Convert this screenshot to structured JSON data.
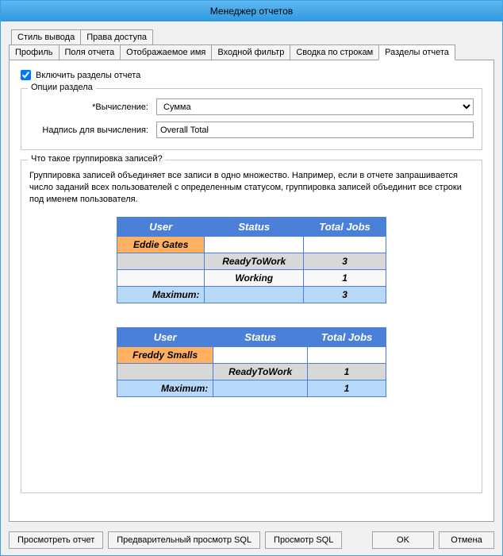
{
  "window": {
    "title": "Менеджер отчетов"
  },
  "tabs_top": [
    {
      "label": "Стиль вывода"
    },
    {
      "label": "Права доступа"
    }
  ],
  "tabs_bottom": [
    {
      "label": "Профиль"
    },
    {
      "label": "Поля отчета"
    },
    {
      "label": "Отображаемое имя"
    },
    {
      "label": "Входной фильтр"
    },
    {
      "label": "Сводка по строкам"
    },
    {
      "label": "Разделы отчета"
    }
  ],
  "enable_sections": {
    "label": "Включить разделы отчета",
    "checked": true
  },
  "section_options": {
    "legend": "Опции раздела",
    "calc_label": "*Вычисление:",
    "calc_value": "Сумма",
    "caption_label": "Надпись для вычисления:",
    "caption_value": "Overall Total"
  },
  "grouping": {
    "legend": "Что такое группировка записей?",
    "text": "Группировка записей объединяет все записи в одно множество. Например, если в отчете запрашивается число заданий всех пользователей с определенным статусом, группировка записей объединит все строки под именем пользователя."
  },
  "example_headers": {
    "user": "User",
    "status": "Status",
    "total": "Total Jobs"
  },
  "example1": {
    "name": "Eddie Gates",
    "rows": [
      {
        "status": "ReadyToWork",
        "total": "3"
      },
      {
        "status": "Working",
        "total": "1"
      }
    ],
    "max_label": "Maximum:",
    "max_value": "3"
  },
  "example2": {
    "name": "Freddy Smalls",
    "rows": [
      {
        "status": "ReadyToWork",
        "total": "1"
      }
    ],
    "max_label": "Maximum:",
    "max_value": "1"
  },
  "buttons": {
    "preview_report": "Просмотреть отчет",
    "preview_sql": "Предварительный просмотр SQL",
    "view_sql": "Просмотр SQL",
    "ok": "OK",
    "cancel": "Отмена"
  }
}
